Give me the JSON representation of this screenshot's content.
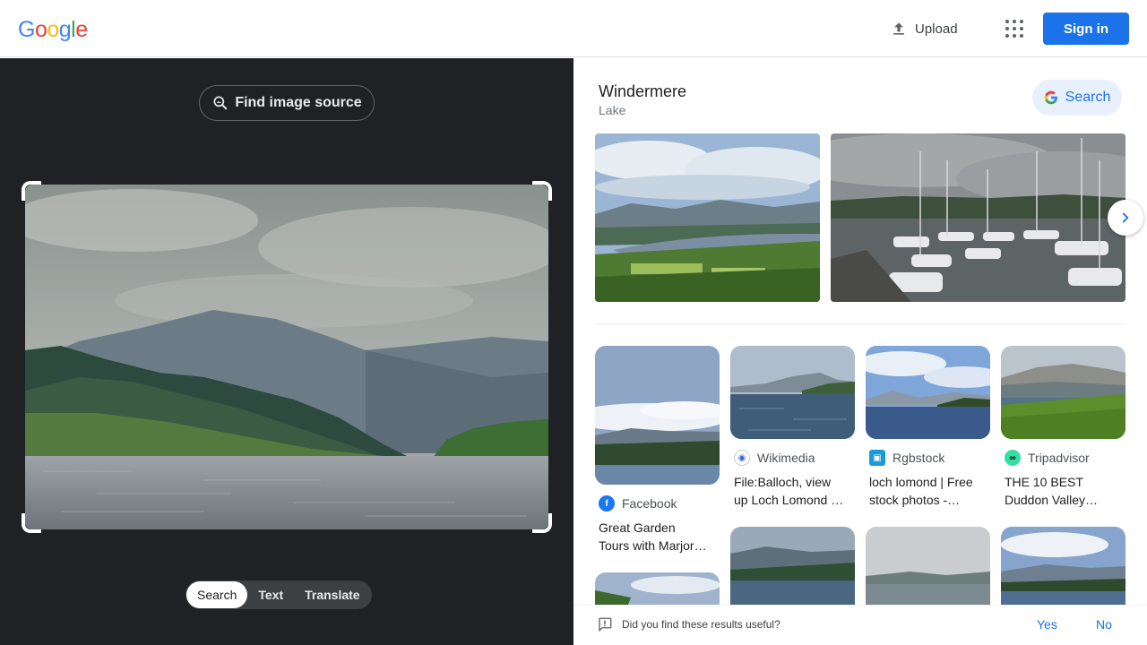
{
  "header": {
    "logo": "Google",
    "upload_label": "Upload",
    "signin_label": "Sign in"
  },
  "left_panel": {
    "find_source_label": "Find image source",
    "mode_tabs": [
      {
        "label": "Search",
        "active": true
      },
      {
        "label": "Text",
        "active": false
      },
      {
        "label": "Translate",
        "active": false
      }
    ]
  },
  "right_panel": {
    "entity_title": "Windermere",
    "entity_subtitle": "Lake",
    "search_button_label": "Search",
    "results": [
      {
        "source": "Facebook",
        "title_line1": "Great Garden",
        "title_line2": "Tours with Marjor…",
        "favicon_color": "#1877f2",
        "favicon_icon": "facebook-icon"
      },
      {
        "source": "Wikimedia",
        "title_line1": "File:Balloch, view",
        "title_line2": "up Loch Lomond …",
        "favicon_color": "#3366cc",
        "favicon_icon": "wikimedia-icon"
      },
      {
        "source": "Rgbstock",
        "title_line1": "loch lomond | Free",
        "title_line2": "stock photos -…",
        "favicon_color": "#1a9bd7",
        "favicon_icon": "rgbstock-icon"
      },
      {
        "source": "Tripadvisor",
        "title_line1": "THE 10 BEST",
        "title_line2": "Duddon Valley…",
        "favicon_color": "#34e0a1",
        "favicon_icon": "tripadvisor-icon"
      }
    ]
  },
  "feedback": {
    "question": "Did you find these results useful?",
    "yes_label": "Yes",
    "no_label": "No"
  },
  "colors": {
    "primary_blue": "#1a73e8",
    "left_bg": "#202124"
  }
}
